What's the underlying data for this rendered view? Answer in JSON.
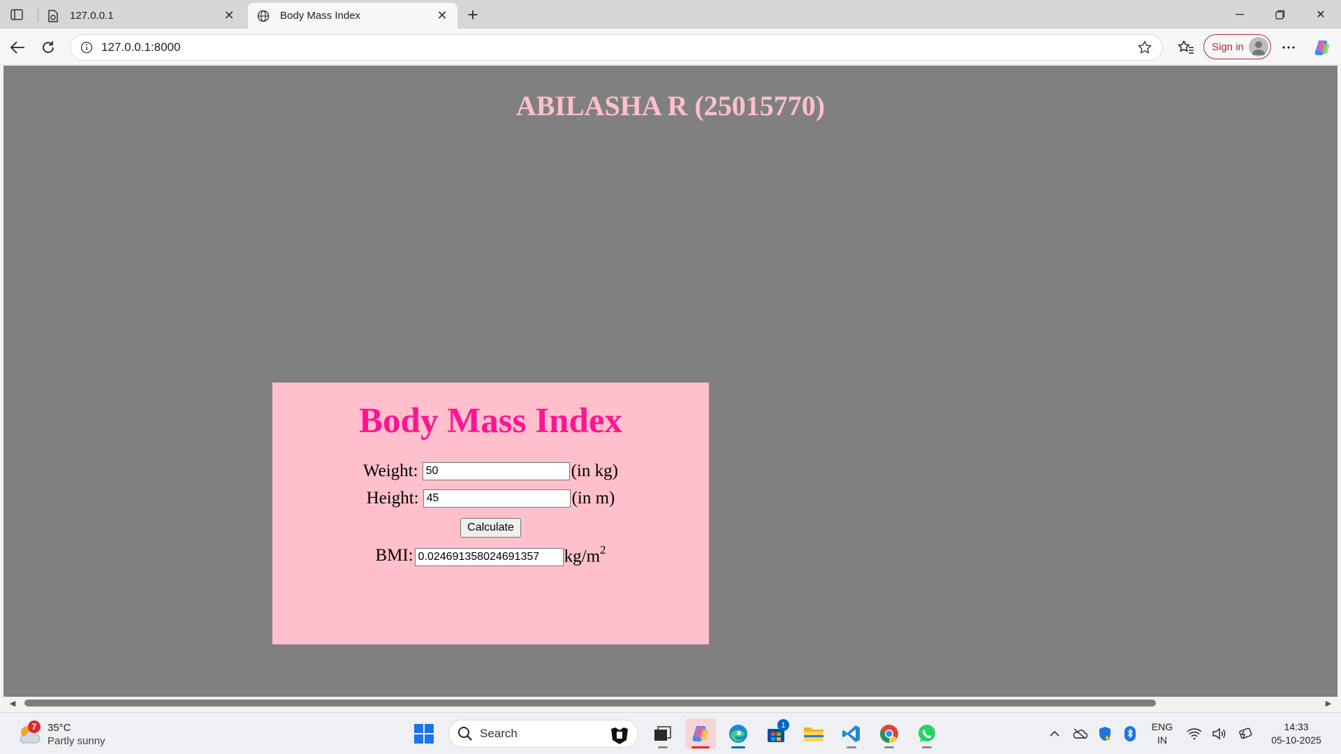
{
  "browser": {
    "tabs": [
      {
        "title": "127.0.0.1",
        "active": false
      },
      {
        "title": "Body Mass Index",
        "active": true
      }
    ],
    "url": "127.0.0.1:8000",
    "signin_label": "Sign in"
  },
  "page": {
    "heading": "ABILASHA R (25015770)",
    "form": {
      "title": "Body Mass Index",
      "weight_label": "Weight:",
      "weight_value": "50",
      "weight_unit": "(in kg)",
      "height_label": "Height:",
      "height_value": "45",
      "height_unit": "(in m)",
      "calculate_label": "Calculate",
      "bmi_label": "BMI:",
      "bmi_value": "0.024691358024691357",
      "bmi_unit": "kg/m",
      "bmi_unit_exp": "2"
    },
    "colors": {
      "page_bg": "#808080",
      "heading": "#ffc0cb",
      "card_bg": "#ffc0cb",
      "card_title": "#ff1493"
    }
  },
  "taskbar": {
    "weather": {
      "badge": "7",
      "temp": "35°C",
      "condition": "Partly sunny"
    },
    "search_label": "Search",
    "apps": [
      "start-icon",
      "search",
      "file-explorer-dark-icon",
      "copilot-icon",
      "edge-icon",
      "store-icon",
      "folder-icon",
      "vscode-icon",
      "chrome-icon",
      "whatsapp-icon"
    ],
    "store_badge": "1",
    "language": {
      "line1": "ENG",
      "line2": "IN"
    },
    "clock": {
      "time": "14:33",
      "date": "05-10-2025"
    }
  }
}
